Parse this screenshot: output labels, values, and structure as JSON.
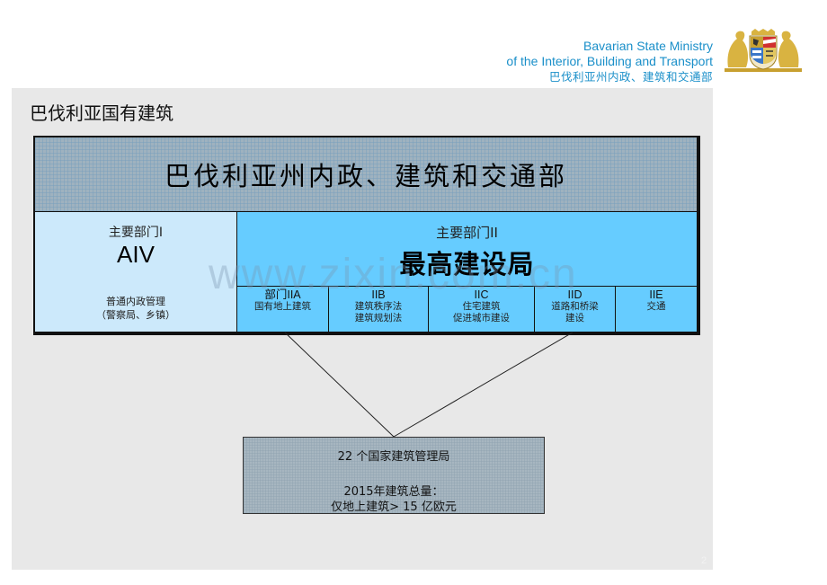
{
  "header": {
    "line1": "Bavarian State Ministry",
    "line2": "of the Interior, Building and Transport",
    "line3": "巴伐利亚州内政、建筑和交通部",
    "logo": "bavarian-coat-of-arms",
    "color": "#1a8fc9"
  },
  "slide": {
    "title": "巴伐利亚国有建筑",
    "page_number": "2"
  },
  "org_chart": {
    "ministry": "巴伐利亚州内政、建筑和交通部",
    "department_i": {
      "label": "主要部门I",
      "code": "AIV",
      "desc_line1": "普通内政管理",
      "desc_line2": "（警察局、乡镇）"
    },
    "department_ii": {
      "label": "主要部门II",
      "name": "最高建设局",
      "subdivisions": [
        {
          "code": "部门IIA",
          "line1": "国有地上建筑",
          "line2": ""
        },
        {
          "code": "IIB",
          "line1": "建筑秩序法",
          "line2": "建筑规划法"
        },
        {
          "code": "IIC",
          "line1": "住宅建筑",
          "line2": "促进城市建设"
        },
        {
          "code": "IID",
          "line1": "道路和桥梁",
          "line2": "建设"
        },
        {
          "code": "IIE",
          "line1": "交通",
          "line2": ""
        }
      ]
    },
    "summary": {
      "line1": "22 个国家建筑管理局",
      "line2": "2015年建筑总量：",
      "line3": "仅地上建筑> 15 亿欧元"
    }
  },
  "watermark": "www.zixin.com.cn",
  "colors": {
    "ministry_bg": "#9fb2bf",
    "dept_i_bg": "#cce9fb",
    "dept_ii_bg": "#66ccff",
    "summary_bg": "#a7b6c0",
    "panel_bg": "#e8e8e8"
  }
}
